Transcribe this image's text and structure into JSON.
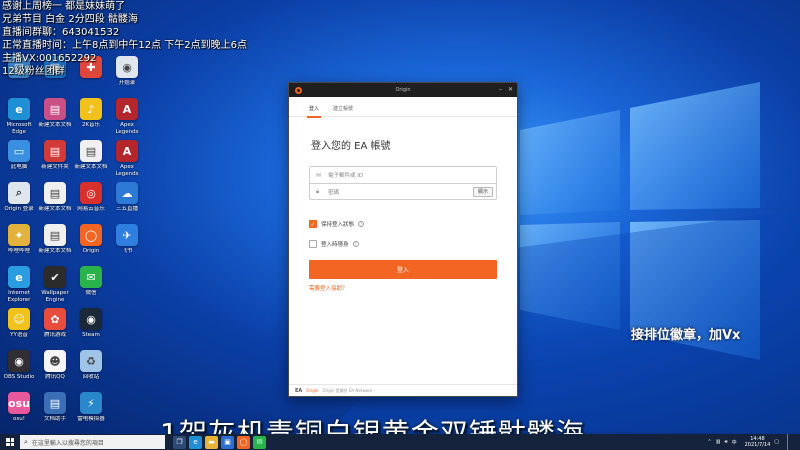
{
  "overlay_lines": [
    "感谢上周榜一 都是妹妹萌了",
    "兄弟节目 白金 2分四段 骷髅海",
    "直播间群聊：643041532",
    "正常直播时间：上午8点到中午12点 下午2点到晚上6点",
    "主播VX:001652292",
    "12级粉丝团群"
  ],
  "promo_text": "接排位徽章，加Vx",
  "marquee_text": "1架灰机青铜白银黄金双锤骷髅海",
  "desktop_icons": [
    {
      "label": "",
      "icon": "app-icon",
      "color": "#3b82c4",
      "glyph": "▢"
    },
    {
      "label": "",
      "icon": "app-icon",
      "color": "#1f6fbf",
      "glyph": "▣"
    },
    {
      "label": "",
      "icon": "security-shield-icon",
      "color": "#e0473a",
      "glyph": "✚"
    },
    {
      "label": "开始录",
      "icon": "controller-icon",
      "color": "#dfe6ee",
      "glyph": "◉"
    },
    {
      "label": "Microsoft Edge",
      "icon": "edge-icon",
      "color": "#1f8fd6",
      "glyph": "e"
    },
    {
      "label": "新建文本文档",
      "icon": "document-icon",
      "color": "#c94f86",
      "glyph": "▤"
    },
    {
      "label": "2K音乐",
      "icon": "music-icon",
      "color": "#f2c21c",
      "glyph": "♪"
    },
    {
      "label": "Apex Legends",
      "icon": "apex-icon",
      "color": "#b3262b",
      "glyph": "A"
    },
    {
      "label": "此电脑",
      "icon": "computer-icon",
      "color": "#3a8fe0",
      "glyph": "▭"
    },
    {
      "label": "新建文件夹",
      "icon": "folder-icon",
      "color": "#d23a3a",
      "glyph": "▤"
    },
    {
      "label": "新建文本文档",
      "icon": "document-icon",
      "color": "#f0f0f0",
      "glyph": "▤"
    },
    {
      "label": "Apex Legends",
      "icon": "apex-icon",
      "color": "#b3262b",
      "glyph": "A"
    },
    {
      "label": "Origin 登录",
      "icon": "search-icon",
      "color": "#dfe6ee",
      "glyph": "⌕"
    },
    {
      "label": "新建文本文档",
      "icon": "document-icon",
      "color": "#f0f0f0",
      "glyph": "▤"
    },
    {
      "label": "网易云音乐",
      "icon": "netease-music-icon",
      "color": "#d8302c",
      "glyph": "◎"
    },
    {
      "label": "三五直播",
      "icon": "cloud-icon",
      "color": "#2d7ad6",
      "glyph": "☁"
    },
    {
      "label": "哔哩哔哩",
      "icon": "game-icon",
      "color": "#e2b23a",
      "glyph": "✦"
    },
    {
      "label": "新建文本文档",
      "icon": "document-icon",
      "color": "#f0f0f0",
      "glyph": "▤"
    },
    {
      "label": "Origin",
      "icon": "origin-icon",
      "color": "#f26522",
      "glyph": "◯"
    },
    {
      "label": "飞书",
      "icon": "bird-icon",
      "color": "#2f7fe0",
      "glyph": "✈"
    },
    {
      "label": "Internet Explorer",
      "icon": "ie-icon",
      "color": "#2a9de0",
      "glyph": "e"
    },
    {
      "label": "Wallpaper Engine",
      "icon": "wallpaper-icon",
      "color": "#2b2b2b",
      "glyph": "✔"
    },
    {
      "label": "微信",
      "icon": "wechat-icon",
      "color": "#29b34a",
      "glyph": "✉"
    },
    {
      "label": "",
      "icon": "blank-icon",
      "color": "transparent",
      "glyph": ""
    },
    {
      "label": "YY语音",
      "icon": "yy-icon",
      "color": "#f2c21c",
      "glyph": "☺"
    },
    {
      "label": "腾讯游戏",
      "icon": "game-icon",
      "color": "#e84c3d",
      "glyph": "✿"
    },
    {
      "label": "Steam",
      "icon": "steam-icon",
      "color": "#1b2838",
      "glyph": "◉"
    },
    {
      "label": "",
      "icon": "blank-icon",
      "color": "transparent",
      "glyph": ""
    },
    {
      "label": "OBS Studio",
      "icon": "obs-icon",
      "color": "#302e31",
      "glyph": "◉"
    },
    {
      "label": "腾讯QQ",
      "icon": "qq-icon",
      "color": "#f5f5f5",
      "glyph": "☻"
    },
    {
      "label": "回收站",
      "icon": "recycle-bin-icon",
      "color": "#9fc4e8",
      "glyph": "♻"
    },
    {
      "label": "",
      "icon": "blank-icon",
      "color": "transparent",
      "glyph": ""
    },
    {
      "label": "osu!",
      "icon": "osu-icon",
      "color": "#e8589c",
      "glyph": "osu"
    },
    {
      "label": "文档助手",
      "icon": "document-icon",
      "color": "#3a6fb8",
      "glyph": "▤"
    },
    {
      "label": "雷电模拟器",
      "icon": "emulator-icon",
      "color": "#2a87c9",
      "glyph": "⚡"
    },
    {
      "label": "",
      "icon": "blank-icon",
      "color": "transparent",
      "glyph": ""
    }
  ],
  "origin_window": {
    "title": "Origin",
    "tabs": [
      "登入",
      "建立帳號"
    ],
    "heading": "登入您的 EA 帳號",
    "email_placeholder": "電子郵件或 ID",
    "password_placeholder": "密碼",
    "show_label": "顯示",
    "remember_label": "保持登入狀態",
    "remember_checked": true,
    "invisible_label": "登入時隱身",
    "invisible_checked": false,
    "login_label": "登入",
    "help_label": "需要登入協助？",
    "footer_ea": "EA",
    "footer_origin": "Origin",
    "footer_text": "Origin 是屬於 EA Network ›"
  },
  "taskbar": {
    "search_placeholder": "在這里輸入以搜尋您的項目",
    "apps": [
      {
        "icon": "task-view-icon",
        "color": "#2b4a78",
        "glyph": "❐"
      },
      {
        "icon": "edge-icon",
        "color": "#1f8fd6",
        "glyph": "e"
      },
      {
        "icon": "folder-icon",
        "color": "#e8b339",
        "glyph": "▬"
      },
      {
        "icon": "store-icon",
        "color": "#2b6fd0",
        "glyph": "▣"
      },
      {
        "icon": "origin-icon",
        "color": "#f26522",
        "glyph": "◯"
      },
      {
        "icon": "chat-icon",
        "color": "#29b34a",
        "glyph": "✉"
      }
    ],
    "time": "14:48",
    "date": "2021/7/14"
  },
  "colors": {
    "accent": "#f26522",
    "taskbar": "#14233b"
  }
}
